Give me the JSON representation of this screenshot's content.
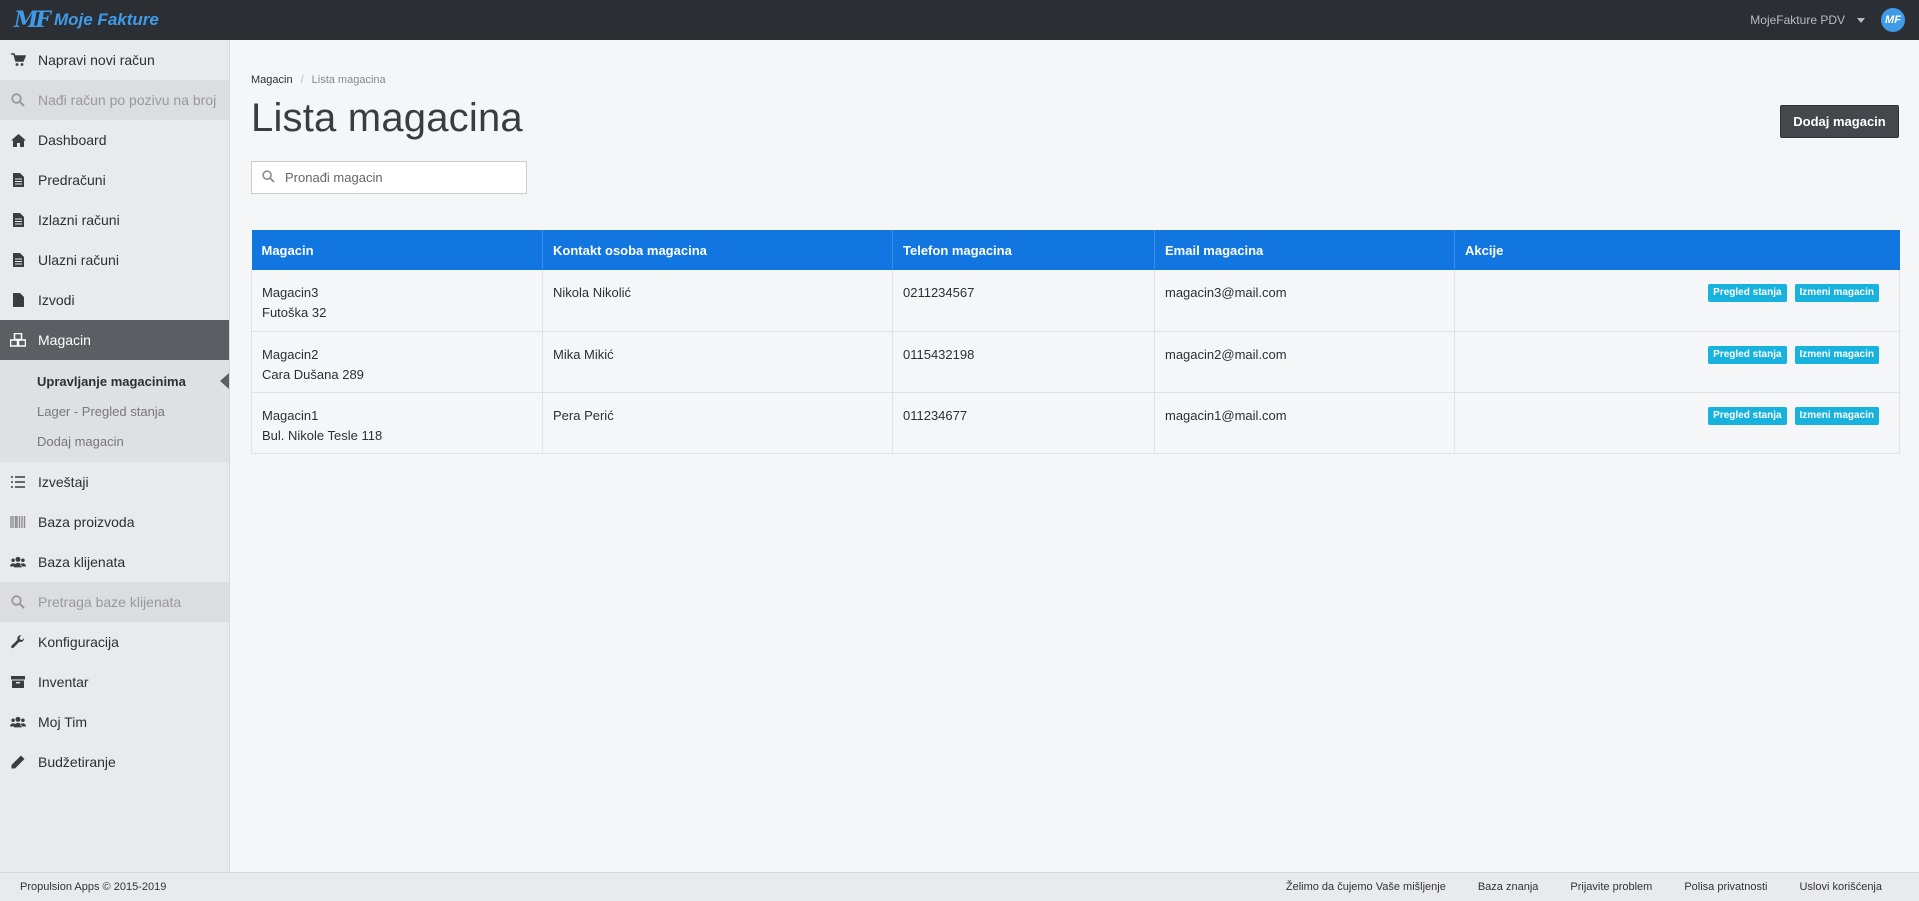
{
  "app": {
    "name": "Moje Fakture",
    "logo_mark": "MF",
    "user_label": "MojeFakture PDV",
    "avatar_text": "MF",
    "accent": "#1176e0"
  },
  "sidebar": {
    "items": [
      {
        "label": "Napravi novi račun",
        "icon": "cart-icon"
      },
      {
        "label": "Nađi račun po pozivu na broj",
        "icon": "search-icon"
      },
      {
        "label": "Dashboard",
        "icon": "home-icon"
      },
      {
        "label": "Predračuni",
        "icon": "document-icon"
      },
      {
        "label": "Izlazni računi",
        "icon": "document-icon"
      },
      {
        "label": "Ulazni računi",
        "icon": "document-icon"
      },
      {
        "label": "Izvodi",
        "icon": "file-icon"
      },
      {
        "label": "Magacin",
        "icon": "cubes-icon"
      },
      {
        "label": "Izveštaji",
        "icon": "list-icon"
      },
      {
        "label": "Baza proizvoda",
        "icon": "barcode-icon"
      },
      {
        "label": "Baza klijenata",
        "icon": "users-icon"
      },
      {
        "label": "Pretraga baze klijenata",
        "icon": "search-icon"
      },
      {
        "label": "Konfiguracija",
        "icon": "wrench-icon"
      },
      {
        "label": "Inventar",
        "icon": "archive-icon"
      },
      {
        "label": "Moj Tim",
        "icon": "users-icon"
      },
      {
        "label": "Budžetiranje",
        "icon": "pencil-icon"
      }
    ],
    "subitems": [
      {
        "label": "Upravljanje magacinima"
      },
      {
        "label": "Lager - Pregled stanja"
      },
      {
        "label": "Dodaj magacin"
      }
    ]
  },
  "breadcrumb": {
    "parent": "Magacin",
    "current": "Lista magacina"
  },
  "page": {
    "title": "Lista magacina",
    "add_button": "Dodaj magacin"
  },
  "search": {
    "placeholder": "Pronađi magacin"
  },
  "table": {
    "headers": [
      "Magacin",
      "Kontakt osoba magacina",
      "Telefon magacina",
      "Email magacina",
      "Akcije"
    ],
    "action_labels": {
      "view": "Pregled stanja",
      "edit": "Izmeni magacin"
    },
    "rows": [
      {
        "name": "Magacin3",
        "address": "Futoška 32",
        "contact": "Nikola Nikolić",
        "phone": "0211234567",
        "email": "magacin3@mail.com"
      },
      {
        "name": "Magacin2",
        "address": "Cara Dušana 289",
        "contact": "Mika Mikić",
        "phone": "0115432198",
        "email": "magacin2@mail.com"
      },
      {
        "name": "Magacin1",
        "address": "Bul. Nikole Tesle 118",
        "contact": "Pera Perić",
        "phone": "011234677",
        "email": "magacin1@mail.com"
      }
    ]
  },
  "footer": {
    "copyright": "Propulsion Apps © 2015-2019",
    "links": [
      "Želimo da čujemo Vaše mišljenje",
      "Baza znanja",
      "Prijavite problem",
      "Polisa privatnosti",
      "Uslovi korišćenja"
    ]
  }
}
